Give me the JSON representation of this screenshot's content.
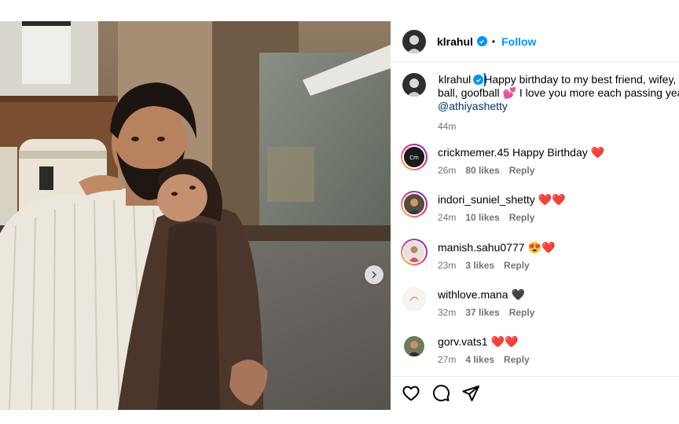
{
  "post": {
    "username": "klrahul",
    "follow_label": "Follow",
    "separator": "•"
  },
  "caption": {
    "username": "klrahul",
    "line1": "Happy birthday to my best friend, wifey, lo",
    "line2": "ball, goofball 💕 I love you more each passing year ❤️",
    "mention": "@athiyashetty",
    "time": "44m"
  },
  "comments": [
    {
      "user": "crickmemer.45",
      "text": "Happy Birthday ❤️",
      "time": "26m",
      "likes": "80 likes",
      "reply": "Reply",
      "ring": "story"
    },
    {
      "user": "indori_suniel_shetty",
      "text": "❤️❤️",
      "time": "24m",
      "likes": "10 likes",
      "reply": "Reply",
      "ring": "story"
    },
    {
      "user": "manish.sahu0777",
      "text": "😍❤️",
      "time": "23m",
      "likes": "3 likes",
      "reply": "Reply",
      "ring": "story"
    },
    {
      "user": "withlove.mana",
      "text": "🖤",
      "time": "32m",
      "likes": "37 likes",
      "reply": "Reply",
      "ring": "none"
    },
    {
      "user": "gorv.vats1",
      "text": "❤️❤️",
      "time": "27m",
      "likes": "4 likes",
      "reply": "Reply",
      "ring": "none"
    }
  ],
  "icons": {
    "like": "heart-icon",
    "comment": "comment-icon",
    "share": "share-icon",
    "next": "chevron-right-icon",
    "verified": "verified-badge-icon"
  },
  "colors": {
    "accent": "#0095f6",
    "link": "#00376b",
    "muted": "#737373"
  }
}
